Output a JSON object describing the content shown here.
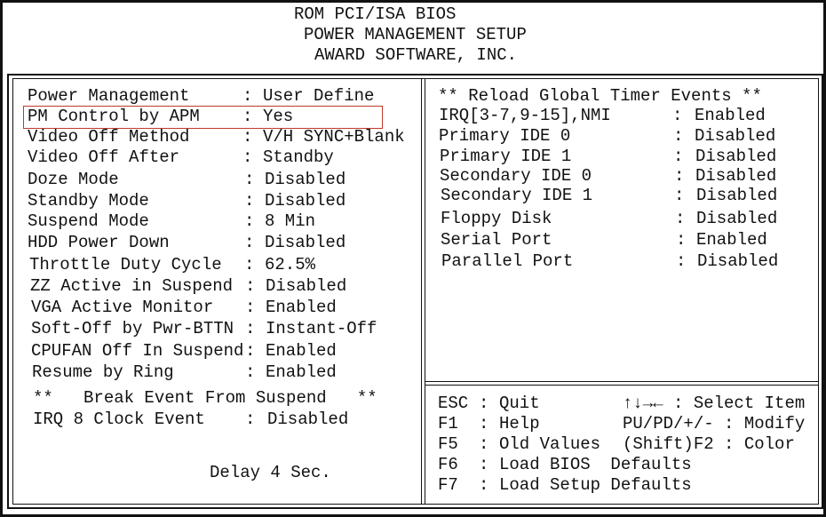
{
  "header": {
    "line1": "ROM PCI/ISA BIOS",
    "line2": "POWER MANAGEMENT SETUP",
    "line3": "AWARD SOFTWARE, INC."
  },
  "left_settings": [
    {
      "label": "Power Management",
      "value": "User Define"
    },
    {
      "label": "PM Control by APM",
      "value": "Yes",
      "highlighted": true
    },
    {
      "label": "Video Off Method",
      "value": "V/H SYNC+Blank"
    },
    {
      "label": "Video Off After",
      "value": "Standby"
    },
    {
      "label": "Doze Mode",
      "value": "Disabled"
    },
    {
      "label": "Standby Mode",
      "value": "Disabled"
    },
    {
      "label": "Suspend Mode",
      "value": "8 Min"
    },
    {
      "label": "HDD Power Down",
      "value": "Disabled"
    },
    {
      "label": "Throttle Duty Cycle",
      "value": "62.5%"
    },
    {
      "label": "ZZ Active in Suspend",
      "value": "Disabled"
    },
    {
      "label": "VGA Active Monitor",
      "value": "Enabled"
    },
    {
      "label": "Soft-Off by Pwr-BTTN",
      "value": "Instant-Off"
    },
    {
      "label": "CPUFAN Off In Suspend",
      "value": "Enabled"
    },
    {
      "label": "Resume by Ring",
      "value": "Enabled"
    }
  ],
  "break_event": {
    "title": "**   Break Event From Suspend   **",
    "label": "IRQ 8 Clock Event",
    "value": "Disabled"
  },
  "delay": "Delay 4 Sec.",
  "reload": {
    "title": "** Reload Global Timer Events **",
    "items": [
      {
        "label": "IRQ[3-7,9-15],NMI",
        "value": "Enabled"
      },
      {
        "label": "Primary IDE 0",
        "value": "Disabled"
      },
      {
        "label": "Primary IDE 1",
        "value": "Disabled"
      },
      {
        "label": "Secondary IDE 0",
        "value": "Disabled"
      },
      {
        "label": "Secondary IDE 1",
        "value": "Disabled"
      },
      {
        "label": "Floppy Disk",
        "value": "Disabled"
      },
      {
        "label": "Serial Port",
        "value": "Enabled"
      },
      {
        "label": "Parallel Port",
        "value": "Disabled"
      }
    ]
  },
  "keys": {
    "left": [
      {
        "key": "ESC",
        "action": "Quit"
      },
      {
        "key": "F1",
        "action": "Help"
      },
      {
        "key": "F5",
        "action": "Old Values"
      },
      {
        "key": "F6",
        "action": "Load BIOS  Defaults"
      },
      {
        "key": "F7",
        "action": "Load Setup Defaults"
      }
    ],
    "right": [
      {
        "key": "↑↓→← ",
        "action": "Select Item"
      },
      {
        "key": "PU/PD/+/- ",
        "action": "Modify"
      },
      {
        "key": "(Shift)F2 ",
        "action": "Color"
      }
    ]
  },
  "colors": {
    "highlight": "#c0392b"
  }
}
